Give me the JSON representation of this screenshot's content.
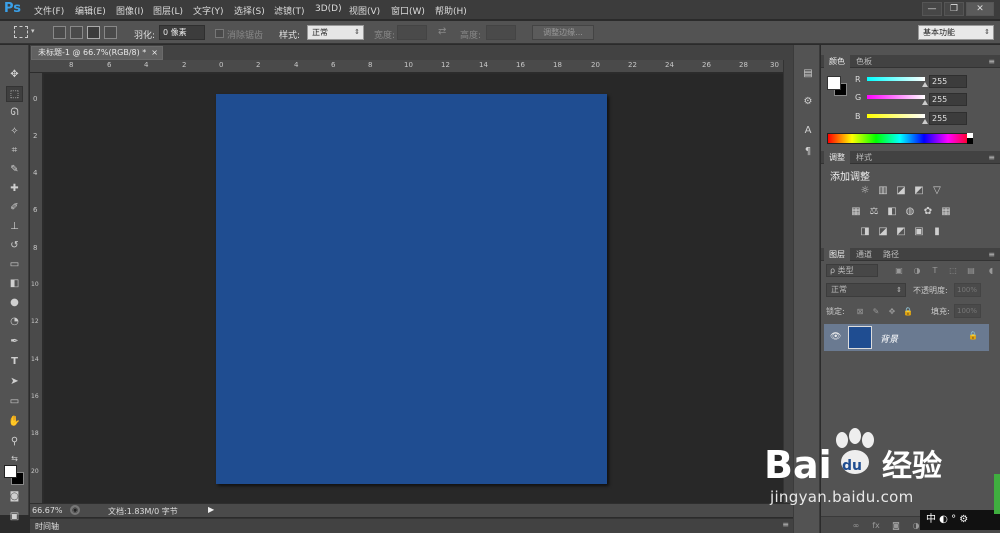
{
  "app": {
    "logo": "Ps",
    "accent": "#3aa0e8"
  },
  "menu": [
    "文件(F)",
    "编辑(E)",
    "图像(I)",
    "图层(L)",
    "文字(Y)",
    "选择(S)",
    "滤镜(T)",
    "3D(D)",
    "视图(V)",
    "窗口(W)",
    "帮助(H)"
  ],
  "window_controls": [
    "—",
    "❐",
    "✕"
  ],
  "options": {
    "feather_label": "羽化:",
    "feather_value": "0 像素",
    "antialias_label": "消除锯齿",
    "style_label": "样式:",
    "style_value": "正常",
    "width_label": "宽度:",
    "height_label": "高度:",
    "refine_edge": "调整边缘...",
    "workspace": "基本功能"
  },
  "document": {
    "tab_title": "未标题-1 @ 66.7%(RGB/8) *",
    "tab_close": "×",
    "canvas_color": "#1f4d91",
    "zoom": "66.67%",
    "doc_info": "文档:1.83M/0 字节"
  },
  "rulers": {
    "horizontal": [
      "8",
      "6",
      "4",
      "2",
      "0",
      "2",
      "4",
      "6",
      "8",
      "10",
      "12",
      "14",
      "16",
      "18",
      "20",
      "22",
      "24",
      "26",
      "28",
      "30"
    ],
    "vertical": [
      "0",
      "2",
      "4",
      "6",
      "8",
      "10",
      "12",
      "14",
      "16",
      "18",
      "20"
    ]
  },
  "timeline": "时间轴",
  "color_panel": {
    "tabs": [
      "颜色",
      "色板"
    ],
    "r_label": "R",
    "g_label": "G",
    "b_label": "B",
    "r": "255",
    "g": "255",
    "b": "255"
  },
  "adjust_panel": {
    "tabs": [
      "调整",
      "样式"
    ],
    "title": "添加调整"
  },
  "layers_panel": {
    "tabs": [
      "图层",
      "通道",
      "路径"
    ],
    "filter_kind": "ρ 类型",
    "blend_mode": "正常",
    "opacity_label": "不透明度:",
    "opacity_value": "100%",
    "lock_label": "锁定:",
    "fill_label": "填充:",
    "fill_value": "100%",
    "layer_name": "背景",
    "layer_color": "#1f4d91"
  },
  "watermark": {
    "brand": "Bai",
    "brand2": "du",
    "brand3": "经验",
    "url": "jingyan.baidu.com",
    "ime": "中 ◐ ° ⚙"
  }
}
